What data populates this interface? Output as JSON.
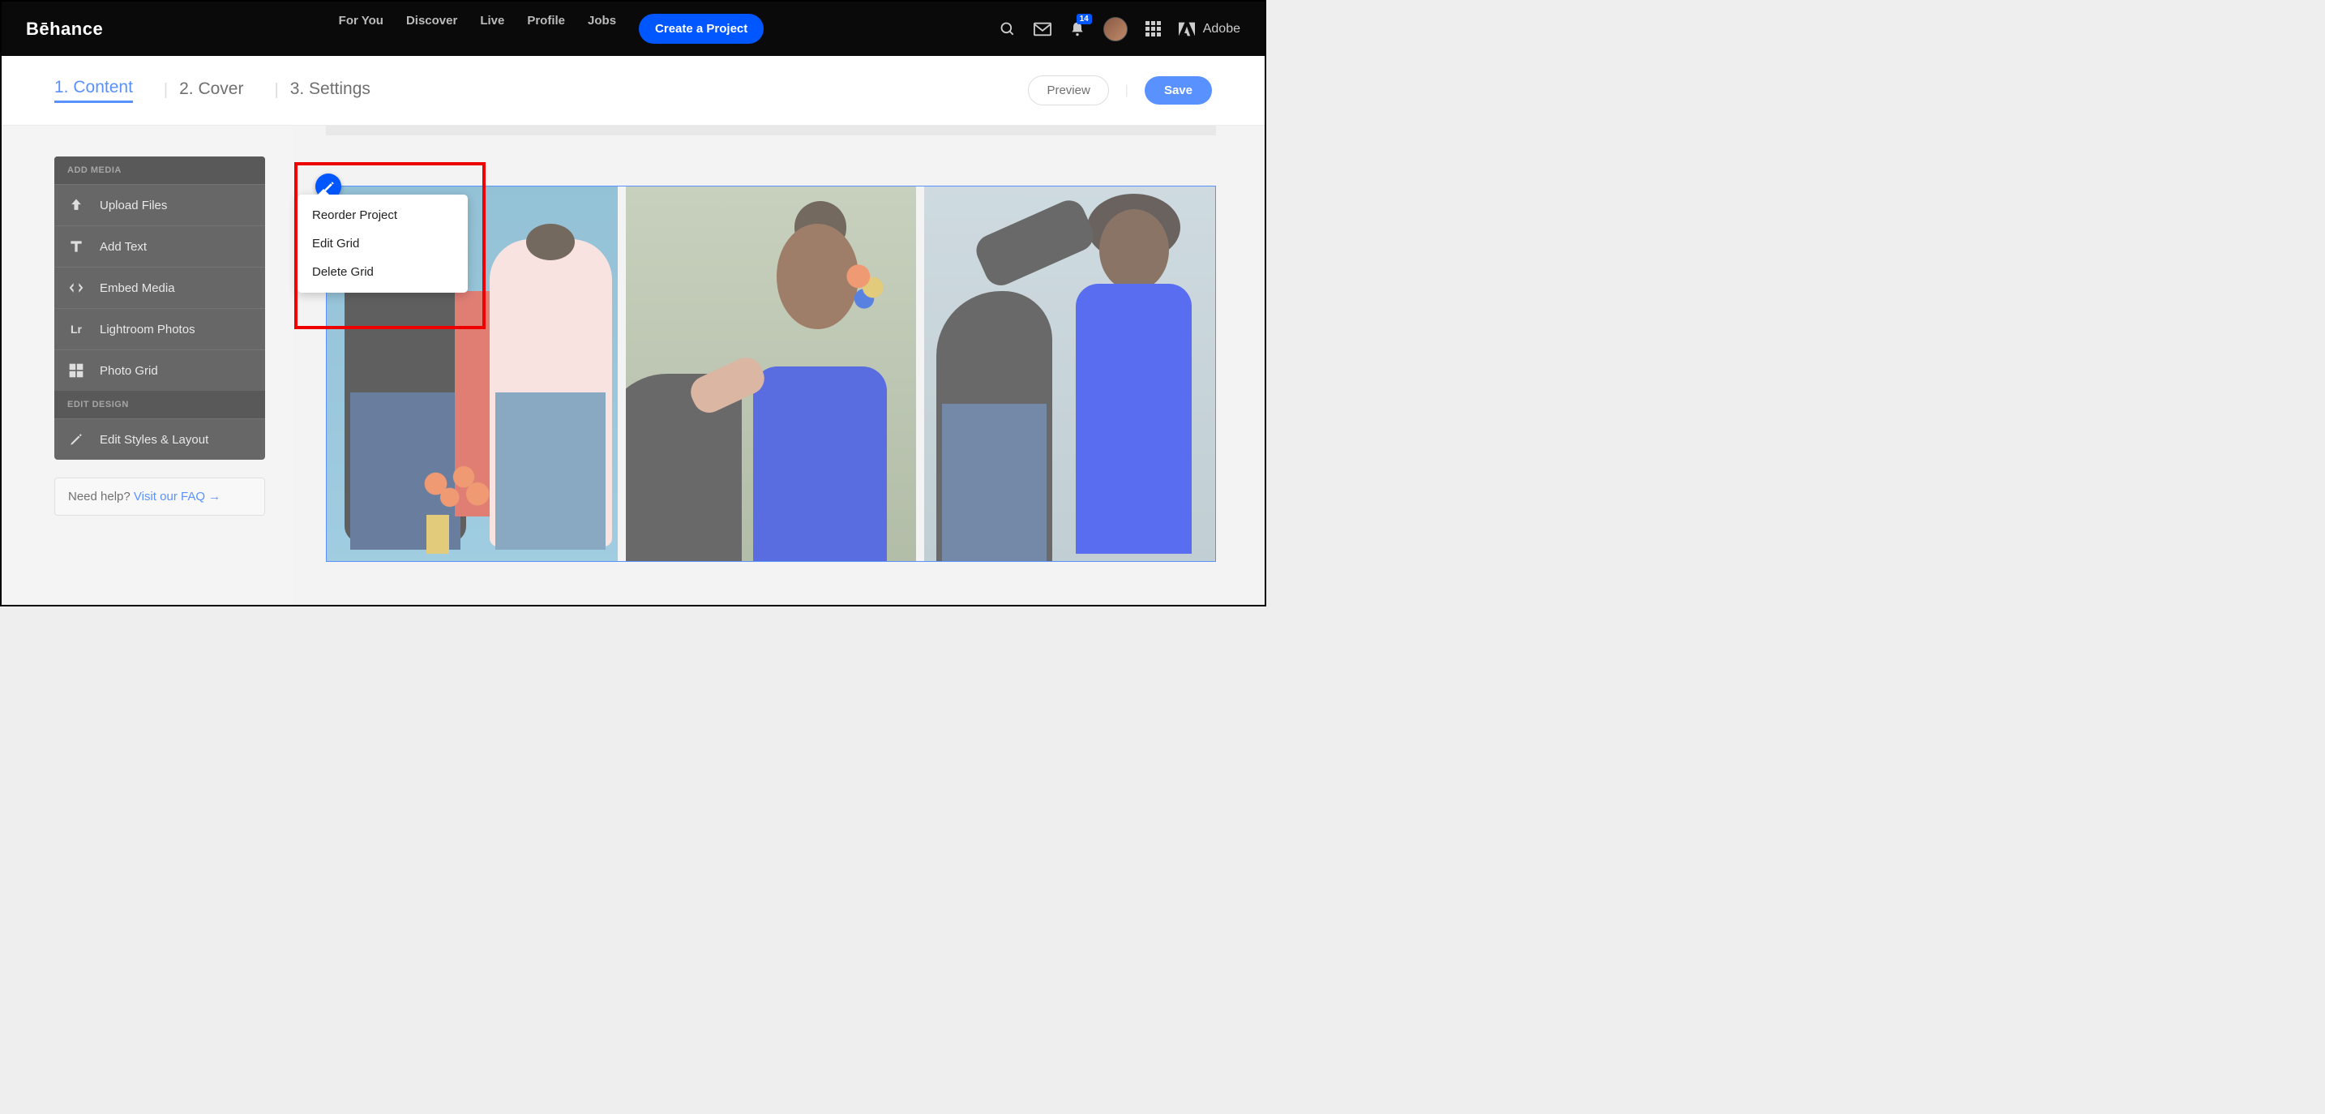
{
  "header": {
    "logo": "Bēhance",
    "nav": {
      "for_you": "For You",
      "discover": "Discover",
      "live": "Live",
      "profile": "Profile",
      "jobs": "Jobs"
    },
    "create_button": "Create a Project",
    "notification_count": "14",
    "adobe_label": "Adobe"
  },
  "tabs": {
    "content": "1. Content",
    "cover": "2. Cover",
    "settings": "3. Settings",
    "preview": "Preview",
    "save": "Save"
  },
  "sidebar": {
    "add_media_header": "ADD MEDIA",
    "items": {
      "upload": "Upload Files",
      "text": "Add Text",
      "embed": "Embed Media",
      "lightroom": "Lightroom Photos",
      "grid": "Photo Grid"
    },
    "edit_design_header": "EDIT DESIGN",
    "edit_styles": "Edit Styles & Layout",
    "help_text": "Need help? ",
    "help_link": "Visit our FAQ →"
  },
  "dropdown": {
    "reorder": "Reorder Project",
    "edit_grid": "Edit Grid",
    "delete_grid": "Delete Grid"
  }
}
